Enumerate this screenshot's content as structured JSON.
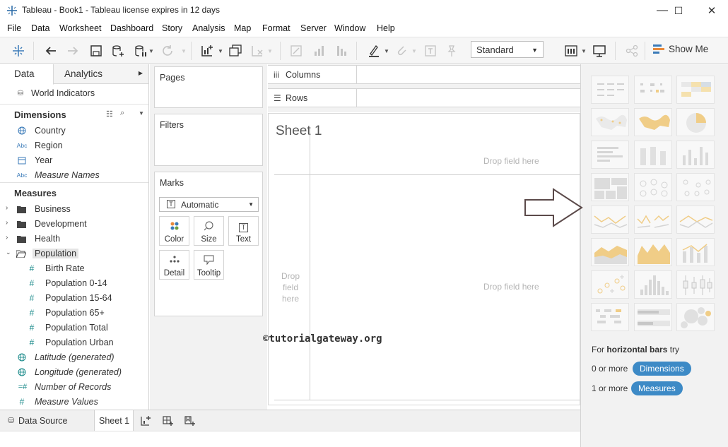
{
  "titlebar": {
    "title": "Tableau - Book1 - Tableau license expires in 12 days",
    "minimize": "—",
    "maximize": "☐",
    "close": "✕"
  },
  "menu": [
    "File",
    "Data",
    "Worksheet",
    "Dashboard",
    "Story",
    "Analysis",
    "Map",
    "Format",
    "Server",
    "Window",
    "Help"
  ],
  "toolbar": {
    "view_size": "Standard",
    "show_me": "Show Me"
  },
  "left": {
    "tab_data": "Data",
    "tab_analytics": "Analytics",
    "datasource": "World Indicators",
    "dimensions_header": "Dimensions",
    "dimensions": [
      {
        "label": "Country",
        "icon": "globe-icon"
      },
      {
        "label": "Region",
        "icon": "abc-icon"
      },
      {
        "label": "Year",
        "icon": "calendar-icon"
      },
      {
        "label": "Measure Names",
        "icon": "abc-icon"
      }
    ],
    "measures_header": "Measures",
    "folders": [
      "Business",
      "Development",
      "Health",
      "Population"
    ],
    "population_items": [
      "Birth Rate",
      "Population 0-14",
      "Population 15-64",
      "Population 65+",
      "Population Total",
      "Population Urban"
    ],
    "generated": [
      "Latitude (generated)",
      "Longitude (generated)",
      "Number of Records",
      "Measure Values"
    ],
    "abc": "Abc",
    "hash": "#"
  },
  "cards": {
    "pages": "Pages",
    "filters": "Filters",
    "marks": "Marks",
    "mark_type": "Automatic",
    "mark_buttons": [
      "Color",
      "Size",
      "Text",
      "Detail",
      "Tooltip"
    ]
  },
  "shelves": {
    "columns": "Columns",
    "rows": "Rows"
  },
  "sheet": {
    "title": "Sheet 1",
    "drop_top": "Drop field here",
    "drop_main": "Drop field here",
    "drop_left": [
      "Drop",
      "field",
      "here"
    ],
    "watermark": "©tutorialgateway.org"
  },
  "showme": {
    "hint_prefix": "For ",
    "hint_bold": "horizontal bars",
    "hint_suffix": " try",
    "dim_prefix": "0 or more",
    "dim_pill": "Dimensions",
    "mea_prefix": "1 or more",
    "mea_pill": "Measures"
  },
  "bottom": {
    "datasource_tab": "Data Source",
    "sheet_tab": "Sheet 1"
  },
  "colors": {
    "accent": "#3d8ac6",
    "arrow": "#5b4a4a"
  }
}
